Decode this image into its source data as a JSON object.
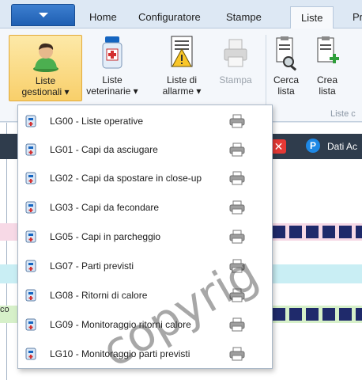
{
  "tabs": [
    {
      "label": "Home"
    },
    {
      "label": "Configuratore"
    },
    {
      "label": "Stampe"
    },
    {
      "label": "Liste"
    },
    {
      "label": "Pr"
    }
  ],
  "ribbon": {
    "liste_gestionali": {
      "line1": "Liste",
      "line2": "gestionali ▾"
    },
    "liste_veterinarie": {
      "line1": "Liste",
      "line2": "veterinarie ▾"
    },
    "liste_allarme": {
      "line1": "Liste di",
      "line2": "allarme ▾"
    },
    "stampa": {
      "line1": "Stampa"
    },
    "cerca_lista": {
      "line1": "Cerca",
      "line2": "lista"
    },
    "crea_lista": {
      "line1": "Crea",
      "line2": "lista"
    },
    "group_label": "Liste c"
  },
  "background": {
    "nav_text": "Dati Ac",
    "p_badge": "P",
    "x_badge": "✕",
    "left_stub": "co"
  },
  "menu_items": [
    {
      "label": "LG00 - Liste operative"
    },
    {
      "label": "LG01 - Capi da asciugare"
    },
    {
      "label": "LG02 - Capi da spostare in close-up"
    },
    {
      "label": "LG03 - Capi da fecondare"
    },
    {
      "label": "LG05 - Capi in parcheggio"
    },
    {
      "label": "LG07 - Parti previsti"
    },
    {
      "label": "LG08 - Ritorni di calore"
    },
    {
      "label": "LG09 - Monitoraggio ritorni calore"
    },
    {
      "label": "LG10 - Monitoraggio parti previsti"
    }
  ],
  "watermark": "copyrig",
  "colors": {
    "accent": "#1f5fb2",
    "selected": "#f8cf6a",
    "navbar": "#2f3c4c"
  }
}
